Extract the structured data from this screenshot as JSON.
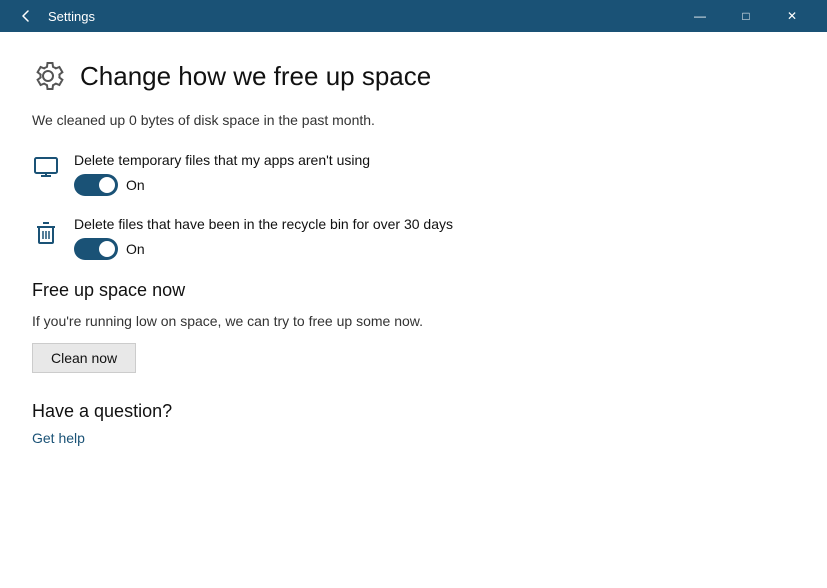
{
  "titlebar": {
    "title": "Settings",
    "minimize_label": "—",
    "maximize_label": "□",
    "close_label": "✕"
  },
  "page": {
    "title": "Change how we free up space",
    "subtitle": "We cleaned up 0 bytes of disk space in the past month.",
    "settings": [
      {
        "id": "temp-files",
        "label": "Delete temporary files that my apps aren't using",
        "toggle_state": "On",
        "enabled": true
      },
      {
        "id": "recycle-bin",
        "label": "Delete files that have been in the recycle bin for over 30 days",
        "toggle_state": "On",
        "enabled": true
      }
    ],
    "free_up_section": {
      "title": "Free up space now",
      "description": "If you're running low on space, we can try to free up some now.",
      "clean_button_label": "Clean now"
    },
    "help_section": {
      "title": "Have a question?",
      "link_label": "Get help"
    }
  }
}
